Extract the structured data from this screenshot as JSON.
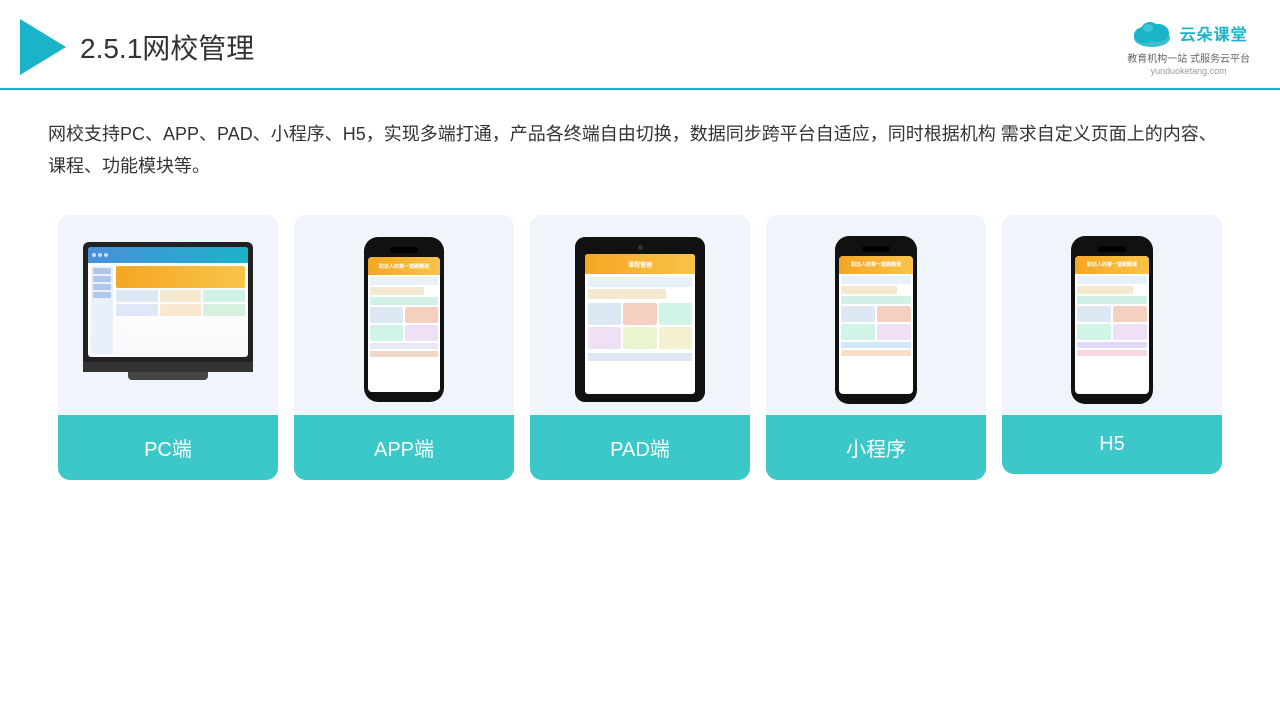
{
  "header": {
    "title_prefix": "2.5.1",
    "title_main": "网校管理"
  },
  "logo": {
    "name": "云朵课堂",
    "url": "yunduoketang.com",
    "tagline": "教育机构一站\n式服务云平台"
  },
  "description": "网校支持PC、APP、PAD、小程序、H5，实现多端打通，产品各终端自由切换，数据同步跨平台自适应，同时根据机构\n需求自定义页面上的内容、课程、功能模块等。",
  "cards": [
    {
      "id": "pc",
      "label": "PC端"
    },
    {
      "id": "app",
      "label": "APP端"
    },
    {
      "id": "pad",
      "label": "PAD端"
    },
    {
      "id": "miniprogram",
      "label": "小程序"
    },
    {
      "id": "h5",
      "label": "H5"
    }
  ],
  "colors": {
    "accent": "#1ab3c8",
    "card_bg": "#f0f4fb",
    "card_label_bg": "#3cc8c8",
    "card_label_text": "#ffffff"
  }
}
